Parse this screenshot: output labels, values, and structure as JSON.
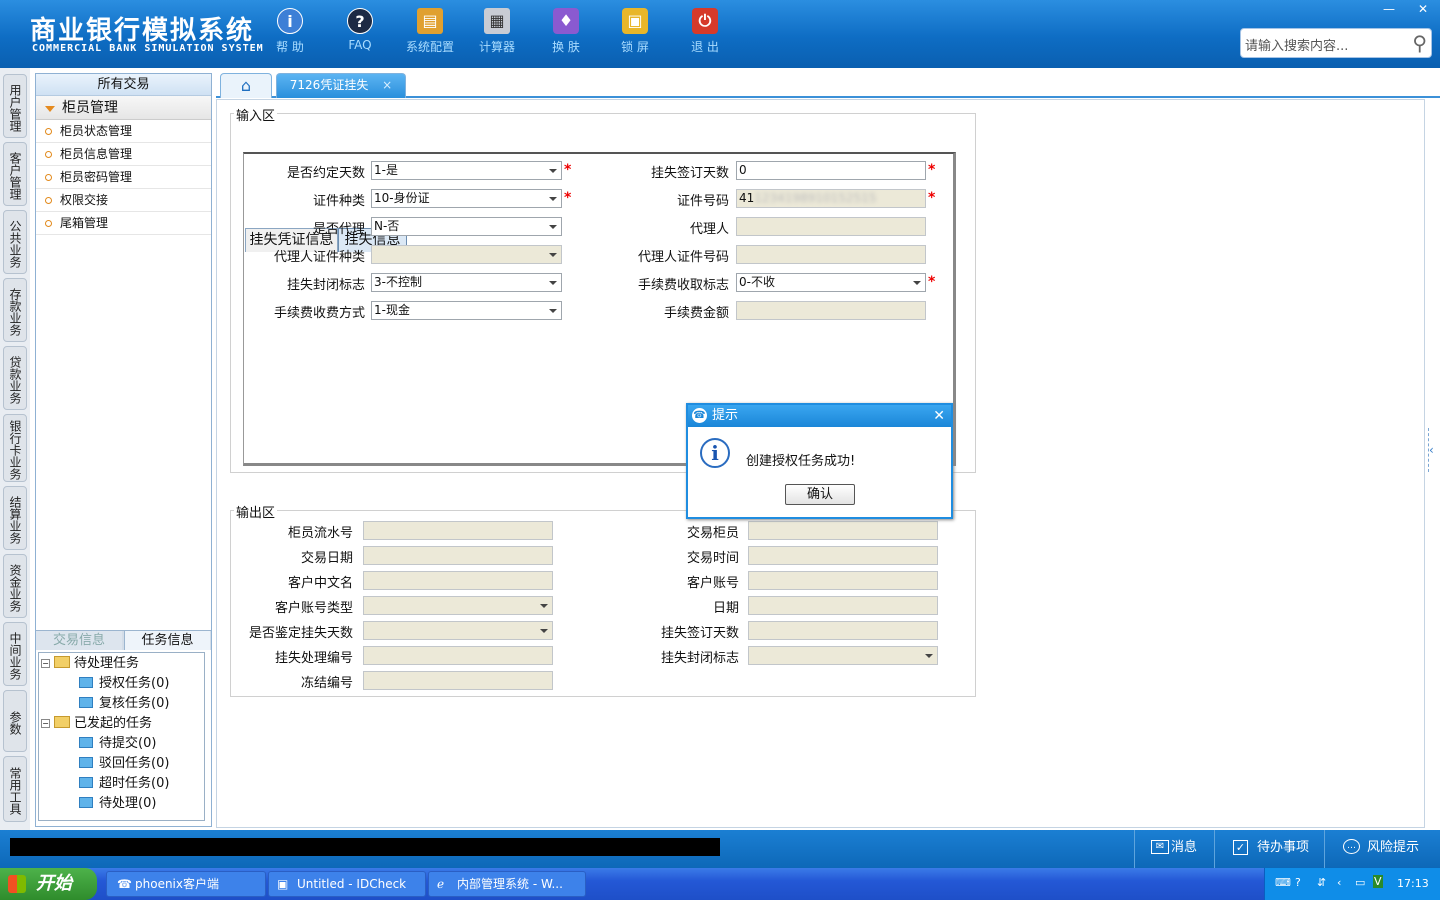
{
  "header": {
    "title": "商业银行模拟系统",
    "subtitle": "COMMERCIAL BANK SIMULATION SYSTEM",
    "tools": [
      {
        "label": "帮 助",
        "icon": "info-icon"
      },
      {
        "label": "FAQ",
        "icon": "question-icon"
      },
      {
        "label": "系统配置",
        "icon": "toolbox-icon"
      },
      {
        "label": "计算器",
        "icon": "calculator-icon"
      },
      {
        "label": "换 肤",
        "icon": "shirt-icon"
      },
      {
        "label": "锁 屏",
        "icon": "lock-icon"
      },
      {
        "label": "退 出",
        "icon": "power-icon"
      }
    ],
    "search_placeholder": "请输入搜索内容...",
    "win_min": "—",
    "win_close": "✕"
  },
  "vtabs": [
    "用户管理",
    "客户管理",
    "公共业务",
    "存款业务",
    "贷款业务",
    "银行卡业务",
    "结算业务",
    "资金业务",
    "中间业务",
    "参数",
    "常用工具"
  ],
  "sidebar": {
    "header": "所有交易",
    "group": "柜员管理",
    "items": [
      "柜员状态管理",
      "柜员信息管理",
      "柜员密码管理",
      "权限交接",
      "尾箱管理"
    ],
    "tabs": [
      "交易信息",
      "任务信息"
    ],
    "tree": {
      "pending": "待处理任务",
      "auth": "授权任务(0)",
      "review": "复核任务(0)",
      "initiated": "已发起的任务",
      "to_submit": "待提交(0)",
      "rejected": "驳回任务(0)",
      "timeout": "超时任务(0)",
      "to_process": "待处理(0)"
    }
  },
  "tabs": {
    "active": "7126凭证挂失",
    "close": "×"
  },
  "input_area": {
    "legend": "输入区",
    "tabs": [
      "挂失凭证信息",
      "挂失信息"
    ],
    "fields": {
      "agreed_days_lbl": "是否约定天数",
      "agreed_days": "1-是",
      "sign_days_lbl": "挂失签订天数",
      "sign_days": "0",
      "id_type_lbl": "证件种类",
      "id_type": "10-身份证",
      "id_no_lbl": "证件号码",
      "id_no_prefix": "41",
      "id_no_rest": "1234198910152515",
      "agent_lbl": "是否代理",
      "agent": "N-否",
      "agent_name_lbl": "代理人",
      "agent_name": "",
      "agent_id_type_lbl": "代理人证件种类",
      "agent_id_type": "",
      "agent_id_no_lbl": "代理人证件号码",
      "agent_id_no": "",
      "close_flag_lbl": "挂失封闭标志",
      "close_flag": "3-不控制",
      "fee_flag_lbl": "手续费收取标志",
      "fee_flag": "0-不收",
      "fee_method_lbl": "手续费收费方式",
      "fee_method": "1-现金",
      "fee_amount_lbl": "手续费金额",
      "fee_amount": ""
    },
    "required_mark": "*"
  },
  "output_area": {
    "legend": "输出区",
    "labels": {
      "serial": "柜员流水号",
      "teller": "交易柜员",
      "date": "交易日期",
      "time": "交易时间",
      "cname": "客户中文名",
      "account": "客户账号",
      "acct_type": "客户账号类型",
      "day": "日期",
      "verify_days": "是否鉴定挂失天数",
      "sign_days": "挂失签订天数",
      "process_no": "挂失处理编号",
      "close_flag": "挂失封闭标志",
      "freeze_no": "冻结编号"
    }
  },
  "dialog": {
    "title": "提示",
    "message": "创建授权任务成功!",
    "ok": "确认",
    "close": "✕"
  },
  "statusbar": {
    "msg": "消息",
    "todo": "待办事项",
    "risk": "风险提示"
  },
  "taskbar": {
    "start": "开始",
    "tasks": [
      "phoenix客户端",
      "Untitled - IDCheck",
      "内部管理系统 - W..."
    ],
    "clock": "17:13"
  },
  "colors": {
    "header_blue": "#0e6dc4",
    "required_red": "#e00000",
    "dialog_border": "#1f8de0"
  }
}
